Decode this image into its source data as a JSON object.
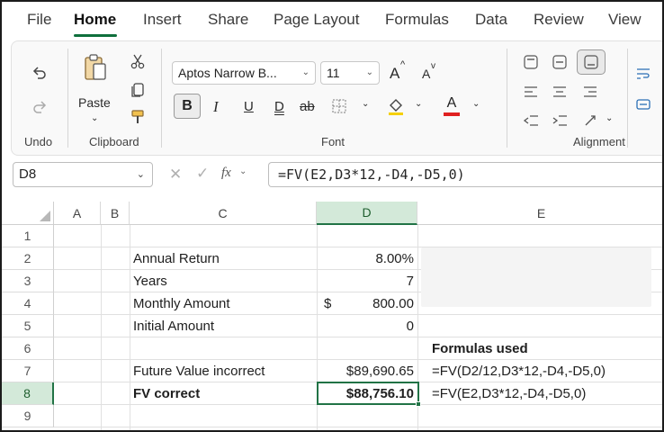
{
  "menu": {
    "tabs": [
      "File",
      "Home",
      "Insert",
      "Share",
      "Page Layout",
      "Formulas",
      "Data",
      "Review",
      "View"
    ],
    "active": "Home"
  },
  "ribbon": {
    "undo_label": "Undo",
    "clipboard_label": "Clipboard",
    "paste_label": "Paste",
    "font_label": "Font",
    "alignment_label": "Alignment",
    "font_name": "Aptos Narrow B...",
    "font_size": "11",
    "bold": "B",
    "italic": "I",
    "underline": "U",
    "double_underline": "D",
    "strike": "ab",
    "grow_font": "A",
    "shrink_font": "A",
    "font_color": "A",
    "colors": {
      "accent": "#217346",
      "font_color_bar": "#e02020",
      "fill_color_bar": "#f5d000"
    }
  },
  "formula_bar": {
    "name_box": "D8",
    "fx": "fx",
    "formula": "=FV(E2,D3*12,-D4,-D5,0)"
  },
  "grid": {
    "columns": [
      "A",
      "B",
      "C",
      "D",
      "E"
    ],
    "rows": [
      "1",
      "2",
      "3",
      "4",
      "5",
      "6",
      "7",
      "8",
      "9"
    ],
    "selected_column": "D",
    "selected_row": "8",
    "cells": {
      "C2": "Annual Return",
      "D2": "8.00%",
      "C3": "Years",
      "D3": "7",
      "C4": "Monthly Amount",
      "D4_symbol": "$",
      "D4": "800.00",
      "C5": "Initial Amount",
      "D5": "0",
      "E6": "Formulas used",
      "C7": "Future Value incorrect",
      "D7": "$89,690.65",
      "E7": "=FV(D2/12,D3*12,-D4,-D5,0)",
      "C8": "FV correct",
      "D8": "$88,756.10",
      "E8": "=FV(E2,D3*12,-D4,-D5,0)"
    }
  }
}
